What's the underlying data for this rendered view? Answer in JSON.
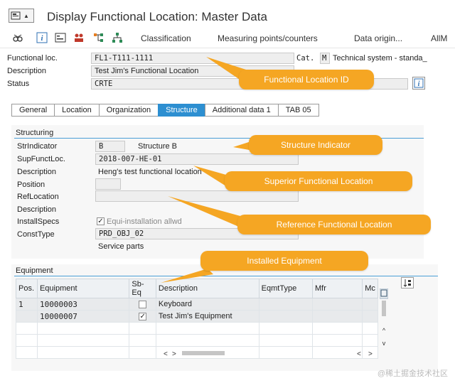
{
  "window": {
    "title": "Display Functional Location: Master Data"
  },
  "toolbar": {
    "items": [
      "Classification",
      "Measuring points/counters",
      "Data origin...",
      "AllM"
    ]
  },
  "header": {
    "funcloc_label": "Functional loc.",
    "funcloc_value": "FL1-T111-1111",
    "cat_label": "Cat.",
    "cat_value": "M",
    "cat_text": "Technical system - standa_",
    "description_label": "Description",
    "description_value": "Test Jim's Functional Location",
    "status_label": "Status",
    "status_value": "CRTE"
  },
  "tabs": [
    "General",
    "Location",
    "Organization",
    "Structure",
    "Additional data 1",
    "TAB 05"
  ],
  "structuring": {
    "title": "Structuring",
    "str_indicator_label": "StrIndicator",
    "str_indicator_value": "B",
    "str_indicator_text": "Structure B",
    "sup_label": "SupFunctLoc.",
    "sup_value": "2018-007-HE-01",
    "sup_desc_label": "Description",
    "sup_desc_value": "Heng's test functional location",
    "position_label": "Position",
    "refloc_label": "RefLocation",
    "ref_desc_label": "Description",
    "install_label": "InstallSpecs",
    "install_check_label": "Equi-installation allwd",
    "const_label": "ConstType",
    "const_value": "PRD_OBJ_02",
    "const_text": "Service parts"
  },
  "equipment": {
    "title": "Equipment",
    "columns": [
      "Pos.",
      "Equipment",
      "Sb-Eq",
      "Description",
      "EqmtType",
      "Mfr",
      "Mc"
    ],
    "rows": [
      {
        "pos": "1",
        "equipment": "10000003",
        "sbeq": "",
        "description": "Keyboard"
      },
      {
        "pos": "",
        "equipment": "10000007",
        "sbeq": "✓",
        "description": "Test Jim's Equipment"
      }
    ]
  },
  "callouts": {
    "funcloc": "Functional Location ID",
    "struct": "Structure Indicator",
    "superior": "Superior Functional Location",
    "reference": "Reference Functional Location",
    "installed": "Installed Equipment"
  },
  "watermark": "@稀土掘金技术社区",
  "colors": {
    "accent": "#2d8fd1",
    "callout": "#f5a623"
  }
}
